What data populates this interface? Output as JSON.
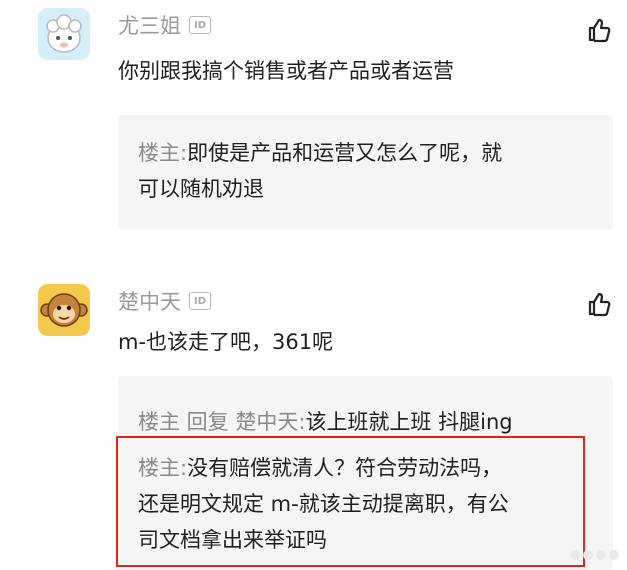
{
  "comments": [
    {
      "username": "尤三姐",
      "id_badge": "ID",
      "text": "你别跟我搞个销售或者产品或者运营",
      "avatar_icon": "sheep-avatar",
      "replies": [
        {
          "op_label": "楼主:",
          "text": "即使是产品和运营又怎么了呢，就",
          "text2": "可以随机劝退"
        }
      ]
    },
    {
      "username": "楚中天",
      "id_badge": "ID",
      "text": "m-也该走了吧，361呢",
      "avatar_icon": "monkey-avatar",
      "replies": [
        {
          "op_label": "楼主 回复 楚中天:",
          "text": "该上班就上班 抖腿ing"
        },
        {
          "op_label": "楼主:",
          "text": "没有赔偿就清人？符合劳动法吗，",
          "text2": "还是明文规定 m-就该主动提离职，有公",
          "text3": "司文档拿出来举证吗",
          "highlighted": true
        }
      ]
    }
  ],
  "colors": {
    "highlight_border": "#e0251c",
    "reply_bg": "#f5f5f5",
    "username": "#9a9a9a"
  }
}
